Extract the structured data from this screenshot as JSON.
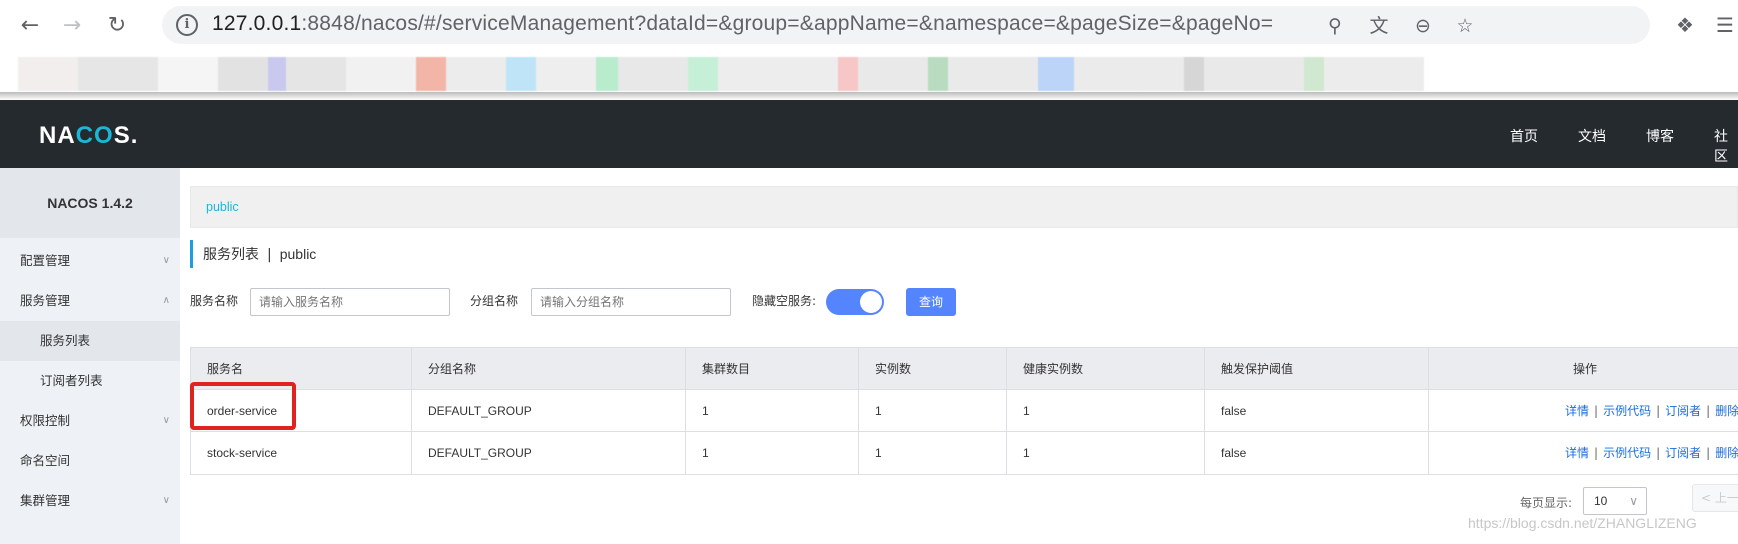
{
  "browser": {
    "url_host": "127.0.0.1",
    "url_rest": ":8848/nacos/#/serviceManagement?dataId=&group=&appName=&namespace=&pageSize=&pageNo="
  },
  "header": {
    "logo": {
      "part1": "NA",
      "part2": "C",
      "part3": "O",
      "part4": "S."
    },
    "nav": [
      "首页",
      "文档",
      "博客",
      "社区"
    ]
  },
  "sidebar": {
    "version": "NACOS 1.4.2",
    "items": [
      {
        "label": "配置管理"
      },
      {
        "label": "服务管理"
      },
      {
        "label": "服务列表"
      },
      {
        "label": "订阅者列表"
      },
      {
        "label": "权限控制"
      },
      {
        "label": "命名空间"
      },
      {
        "label": "集群管理"
      }
    ]
  },
  "breadcrumb": {
    "namespace": "public"
  },
  "page": {
    "title": "服务列表",
    "separator": "|",
    "namespace": "public"
  },
  "search": {
    "service_label": "服务名称",
    "service_placeholder": "请输入服务名称",
    "group_label": "分组名称",
    "group_placeholder": "请输入分组名称",
    "hide_empty_label": "隐藏空服务:",
    "hide_empty_on": true,
    "query_label": "查询"
  },
  "table": {
    "headers": [
      "服务名",
      "分组名称",
      "集群数目",
      "实例数",
      "健康实例数",
      "触发保护阈值",
      "操作"
    ],
    "rows": [
      {
        "name": "order-service",
        "group": "DEFAULT_GROUP",
        "clusters": "1",
        "instances": "1",
        "healthy": "1",
        "threshold": "false"
      },
      {
        "name": "stock-service",
        "group": "DEFAULT_GROUP",
        "clusters": "1",
        "instances": "1",
        "healthy": "1",
        "threshold": "false"
      }
    ],
    "actions": [
      "详情",
      "示例代码",
      "订阅者",
      "删除"
    ]
  },
  "pagination": {
    "label": "每页显示:",
    "page_size": "10",
    "prev_label": "< 上一"
  },
  "watermark": "https://blog.csdn.net/ZHANGLIZENG",
  "colors": {
    "header_bg": "#252a2f",
    "accent": "#1bb6d9",
    "primary": "#5584ff",
    "link": "#1b6ee0",
    "highlight": "#e0231f"
  }
}
